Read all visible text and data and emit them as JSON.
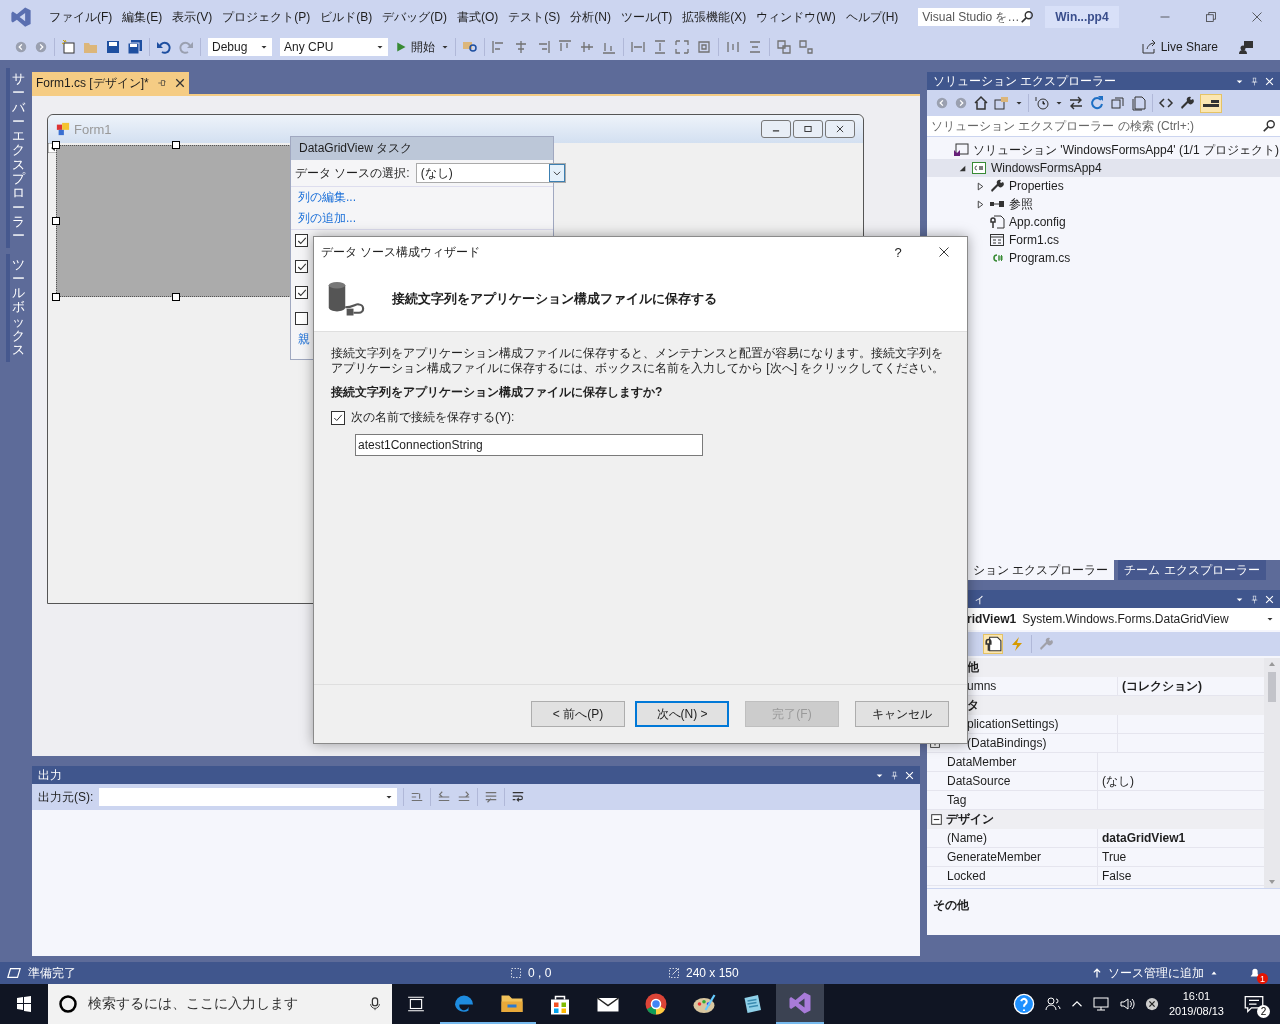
{
  "menu": [
    "ファイル(F)",
    "編集(E)",
    "表示(V)",
    "プロジェクト(P)",
    "ビルド(B)",
    "デバッグ(D)",
    "書式(O)",
    "テスト(S)",
    "分析(N)",
    "ツール(T)",
    "拡張機能(X)",
    "ウィンドウ(W)",
    "ヘルプ(H)"
  ],
  "search": {
    "placeholder": "Visual Studio を…"
  },
  "window_title": "Win...pp4",
  "toolbar": {
    "configuration": "Debug",
    "platform": "Any CPU",
    "start": "開始",
    "live_share": "Live Share"
  },
  "side_tabs": [
    "サーバーエクスプローラー",
    "ツールボックス"
  ],
  "document_tab": {
    "label": "Form1.cs [デザイン]*",
    "selected": true
  },
  "form": {
    "title": "Form1"
  },
  "tasks": {
    "title": "DataGridView タスク",
    "source_label": "データ ソースの選択:",
    "source_value": "(なし)",
    "links": [
      "列の編集...",
      "列の追加..."
    ],
    "options": [
      {
        "checked": true
      },
      {
        "checked": true
      },
      {
        "checked": true
      },
      {
        "checked": false
      }
    ],
    "partial_link": "親"
  },
  "dialog": {
    "title": "データ ソース構成ウィザード",
    "help": "?",
    "heading": "接続文字列をアプリケーション構成ファイルに保存する",
    "description": "接続文字列をアプリケーション構成ファイルに保存すると、メンテナンスと配置が容易になります。接続文字列をアプリケーション構成ファイルに保存するには、ボックスに名前を入力してから [次へ] をクリックしてください。",
    "question": "接続文字列をアプリケーション構成ファイルに保存しますか?",
    "save_option": {
      "label": "次の名前で接続を保存する(Y):",
      "checked": true
    },
    "name_field": {
      "value": "atest1ConnectionString"
    },
    "buttons": [
      {
        "label": "< 前へ(P)",
        "default": false,
        "disabled": false
      },
      {
        "label": "次へ(N) >",
        "default": true,
        "disabled": false
      },
      {
        "label": "完了(F)",
        "default": false,
        "disabled": true
      },
      {
        "label": "キャンセル",
        "default": false,
        "disabled": false
      }
    ]
  },
  "solution_explorer": {
    "title": "ソリューション エクスプローラー",
    "search": {
      "placeholder": "ソリューション エクスプローラー の検索 (Ctrl+:)"
    },
    "tree": [
      {
        "label": "ソリューション 'WindowsFormsApp4' (1/1 プロジェクト)",
        "kind": "solution",
        "selected": false,
        "children": [
          {
            "label": "WindowsFormsApp4",
            "kind": "project",
            "selected": true,
            "expanded": true,
            "children": [
              {
                "label": "Properties",
                "kind": "properties",
                "selected": false,
                "expanded": false
              },
              {
                "label": "参照",
                "kind": "references",
                "selected": false,
                "expanded": false
              },
              {
                "label": "App.config",
                "kind": "config",
                "selected": false
              },
              {
                "label": "Form1.cs",
                "kind": "form",
                "selected": false
              },
              {
                "label": "Program.cs",
                "kind": "code",
                "selected": false
              }
            ]
          }
        ]
      }
    ]
  },
  "bottom_tabs": [
    {
      "label": "ション エクスプローラー",
      "selected": true
    },
    {
      "label": "チーム エクスプローラー",
      "selected": false
    }
  ],
  "properties": {
    "title": "ィ",
    "object_name": "ridView1",
    "object_type": "System.Windows.Forms.DataGridView",
    "categories": [
      {
        "name": "他",
        "rows": [
          {
            "name": "umns",
            "value": "(コレクション)",
            "kind": "plain",
            "modified": true
          }
        ]
      },
      {
        "name": "タ",
        "rows": [
          {
            "name": "plicationSettings)",
            "kind": "plain"
          },
          {
            "name": "(DataBindings)",
            "kind": "expandable"
          },
          {
            "name": "DataMember",
            "kind": "plain"
          },
          {
            "name": "DataSource",
            "value": "(なし)",
            "kind": "plain",
            "modified": false
          },
          {
            "name": "Tag",
            "kind": "plain"
          }
        ]
      },
      {
        "name": "デザイン",
        "expanded": true,
        "rows": [
          {
            "name": "(Name)",
            "value": "dataGridView1",
            "kind": "plain",
            "modified": true
          },
          {
            "name": "GenerateMember",
            "value": "True",
            "kind": "plain",
            "modified": false
          },
          {
            "name": "Locked",
            "value": "False",
            "kind": "plain",
            "modified": false
          }
        ]
      }
    ],
    "description": "その他"
  },
  "output": {
    "title": "出力",
    "source_label": "出力元(S):"
  },
  "status_bar": {
    "state": "準備完了",
    "position": "0 , 0",
    "size": "240 x 150",
    "source_control": "ソース管理に追加",
    "notifications": "1"
  },
  "taskbar": {
    "search": {
      "placeholder": "検索するには、ここに入力します"
    },
    "apps": [
      {
        "kind": "edge",
        "running": true,
        "selected": false
      },
      {
        "kind": "explorer",
        "running": true,
        "selected": false
      },
      {
        "kind": "store",
        "running": false,
        "selected": false
      },
      {
        "kind": "mail",
        "running": false,
        "selected": false
      },
      {
        "kind": "chrome",
        "running": false,
        "selected": false
      },
      {
        "kind": "paint",
        "running": false,
        "selected": false
      },
      {
        "kind": "notepad",
        "running": false,
        "selected": false
      },
      {
        "kind": "vs",
        "running": true,
        "selected": true
      }
    ],
    "time": "16:01",
    "date": "2019/08/13",
    "notifications": "2"
  }
}
